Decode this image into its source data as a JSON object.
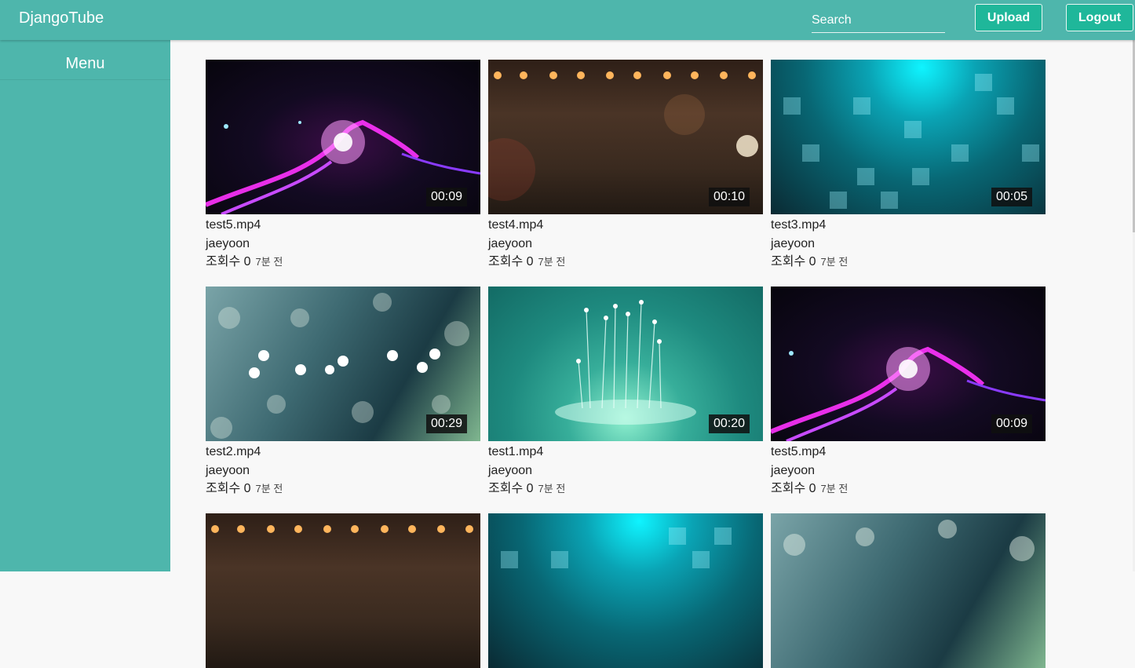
{
  "app": {
    "brand": "DjangoTube"
  },
  "header": {
    "search_placeholder": "Search",
    "upload_label": "Upload",
    "logout_label": "Logout"
  },
  "sidebar": {
    "title": "Menu"
  },
  "videos": [
    {
      "title": "test5.mp4",
      "author": "jaeyoon",
      "views": "조회수 0",
      "time": "7분 전",
      "duration": "00:09",
      "thumb": "lightning"
    },
    {
      "title": "test4.mp4",
      "author": "jaeyoon",
      "views": "조회수 0",
      "time": "7분 전",
      "duration": "00:10",
      "thumb": "stage"
    },
    {
      "title": "test3.mp4",
      "author": "jaeyoon",
      "views": "조회수 0",
      "time": "7분 전",
      "duration": "00:05",
      "thumb": "cyan"
    },
    {
      "title": "test2.mp4",
      "author": "jaeyoon",
      "views": "조회수 0",
      "time": "7분 전",
      "duration": "00:29",
      "thumb": "bokeh"
    },
    {
      "title": "test1.mp4",
      "author": "jaeyoon",
      "views": "조회수 0",
      "time": "7분 전",
      "duration": "00:20",
      "thumb": "fountain"
    },
    {
      "title": "test5.mp4",
      "author": "jaeyoon",
      "views": "조회수 0",
      "time": "7분 전",
      "duration": "00:09",
      "thumb": "lightning"
    }
  ],
  "partial_row_thumbs": [
    "stage",
    "cyan",
    "bokeh"
  ],
  "colors": {
    "header_bg": "#4eb6ac",
    "sidebar_bg": "#4eb6ac",
    "button_bg": "#1fb79a",
    "page_bg": "#f8f8f8"
  }
}
